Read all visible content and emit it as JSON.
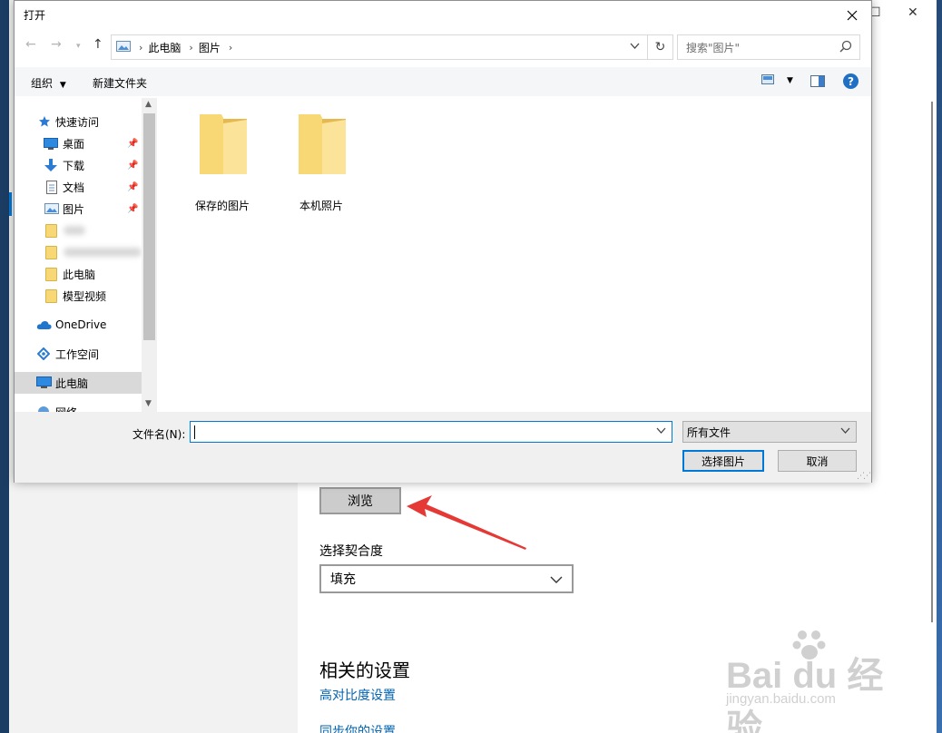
{
  "background_window": {
    "browse_label": "浏览",
    "fit_label": "选择契合度",
    "fit_value": "填充",
    "related_heading": "相关的设置",
    "contrast_link": "高对比度设置",
    "partial_link": "同步你的设置",
    "watermark_main": "Bai du 经验",
    "watermark_sub": "jingyan.baidu.com"
  },
  "dialog": {
    "title": "打开",
    "address": {
      "crumbs": [
        "此电脑",
        "图片"
      ]
    },
    "search_placeholder": "搜索\"图片\"",
    "toolbar": {
      "organize_label": "组织",
      "new_folder_label": "新建文件夹"
    },
    "nav": {
      "items": [
        {
          "label": "快速访问",
          "icon": "star-icon"
        },
        {
          "label": "桌面",
          "icon": "desktop-icon"
        },
        {
          "label": "下载",
          "icon": "download-icon"
        },
        {
          "label": "文档",
          "icon": "document-icon"
        },
        {
          "label": "图片",
          "icon": "pictures-icon"
        },
        {
          "label": "",
          "icon": "folder-icon"
        },
        {
          "label": "",
          "icon": "folder-icon"
        },
        {
          "label": "此电脑",
          "icon": "folder-icon"
        },
        {
          "label": "模型视频",
          "icon": "folder-icon"
        },
        {
          "label": "OneDrive",
          "icon": "cloud-icon"
        },
        {
          "label": "工作空间",
          "icon": "workspace-icon"
        },
        {
          "label": "此电脑",
          "icon": "computer-icon"
        },
        {
          "label": "网络",
          "icon": "network-icon"
        }
      ]
    },
    "folders": [
      {
        "label": "保存的图片"
      },
      {
        "label": "本机照片"
      }
    ],
    "filename_label": "文件名(N):",
    "filename_value": "",
    "filetype_value": "所有文件",
    "open_label": "选择图片",
    "cancel_label": "取消",
    "colors": {
      "accent": "#0078d7",
      "folder": "#f8d775",
      "arrow": "#e53935"
    }
  }
}
